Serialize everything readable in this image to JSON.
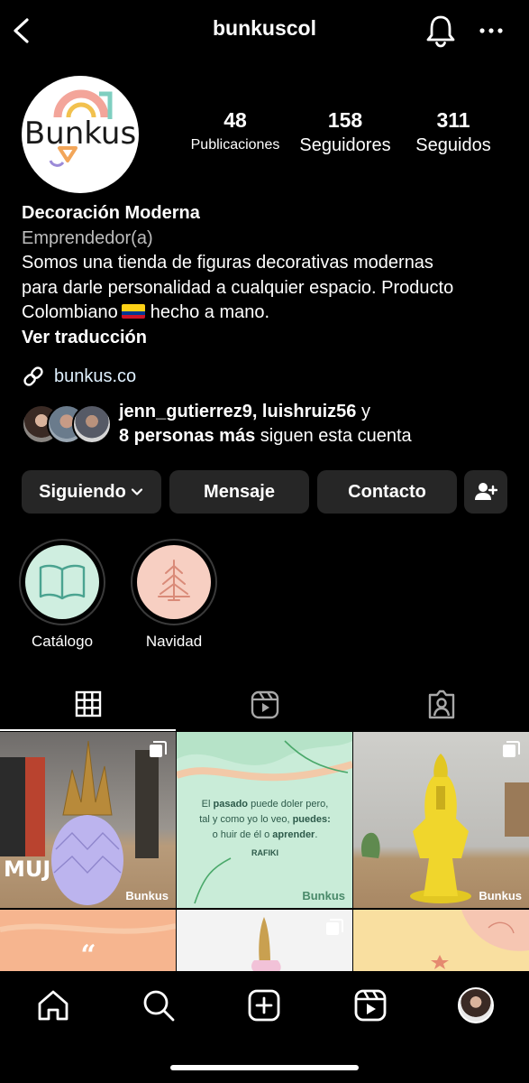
{
  "header": {
    "username": "bunkuscol",
    "icons": [
      "chevron-left-icon",
      "bell-icon",
      "more-horizontal-icon"
    ]
  },
  "profile": {
    "logo_text": "Bunkus",
    "stats": [
      {
        "value": "48",
        "label": "Publicaciones"
      },
      {
        "value": "158",
        "label": "Seguidores"
      },
      {
        "value": "311",
        "label": "Seguidos"
      }
    ],
    "name": "Decoración Moderna",
    "category": "Emprendedor(a)",
    "bio_line1": "Somos una tienda de figuras decorativas modernas",
    "bio_line2": "para darle personalidad a cualquier espacio. Producto",
    "bio_line3_a": "Colombiano",
    "bio_line3_b": "hecho a mano.",
    "translate": "Ver traducción",
    "link": "bunkus.co"
  },
  "followed_by": {
    "users": "jenn_gutierrez9, luishruiz56",
    "conj": "y",
    "more": "8 personas más",
    "suffix": "siguen esta cuenta"
  },
  "actions": {
    "following": "Siguiendo",
    "message": "Mensaje",
    "contact": "Contacto"
  },
  "highlights": [
    {
      "label": "Catálogo",
      "bg": "#cfeee0",
      "icon": "open-book-icon"
    },
    {
      "label": "Navidad",
      "bg": "#f7cfc2",
      "icon": "christmas-tree-icon"
    }
  ],
  "tabs": [
    "grid-icon",
    "reels-icon",
    "tagged-icon"
  ],
  "posts": {
    "watermark": "Bunkus",
    "quote_pre": "El",
    "quote_w1": "pasado",
    "quote_mid1": "puede doler pero,",
    "quote_mid2": "tal y como yo lo veo,",
    "quote_w2": "puedes:",
    "quote_mid3": "o huir de él o",
    "quote_w3": "aprender",
    "quote_end": ".",
    "quote_author": "RAFIKI",
    "book_title": "MUJ"
  },
  "bottom_nav": [
    "home-icon",
    "search-icon",
    "create-icon",
    "reels-icon",
    "profile-avatar"
  ],
  "colors": {
    "background": "#000000",
    "button": "#262626",
    "link": "#e0f1ff",
    "accent_pink": "#f3a59a",
    "accent_orange": "#f2a65a"
  }
}
